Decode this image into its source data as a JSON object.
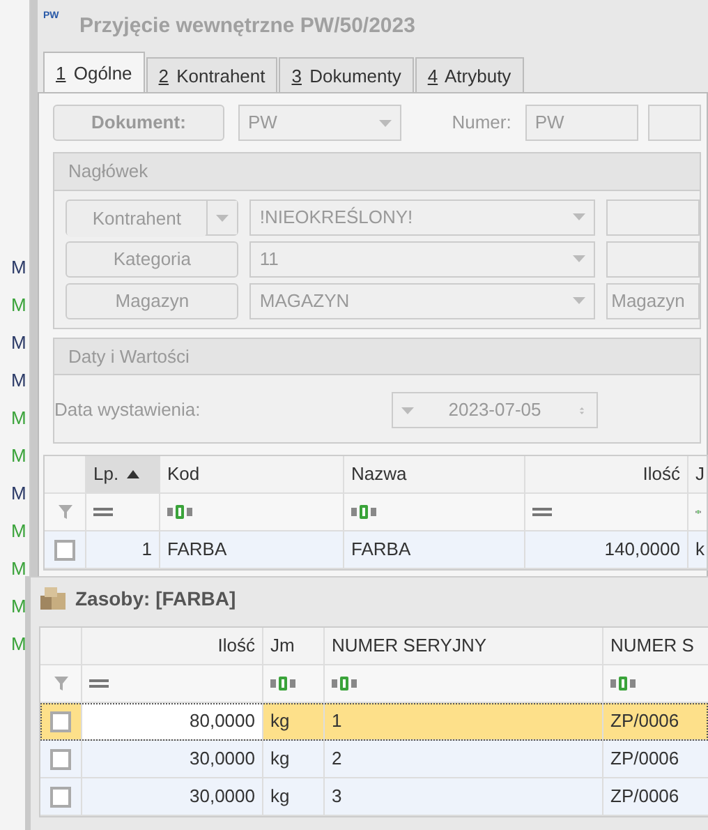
{
  "background_window": {
    "rows": [
      {
        "text": "M",
        "color": "#2b3a67"
      },
      {
        "text": "M",
        "color": "#3aa33a"
      },
      {
        "text": "M",
        "color": "#2b3a67"
      },
      {
        "text": "M",
        "color": "#2b3a67"
      },
      {
        "text": "M",
        "color": "#3aa33a"
      },
      {
        "text": "M",
        "color": "#3aa33a"
      },
      {
        "text": "M",
        "color": "#2b3a67"
      },
      {
        "text": "M",
        "color": "#3aa33a"
      },
      {
        "text": "M",
        "color": "#3aa33a"
      },
      {
        "text": "M",
        "color": "#3aa33a"
      },
      {
        "text": "M",
        "color": "#3aa33a"
      }
    ]
  },
  "window": {
    "icon_text": "PW",
    "title": "Przyjęcie wewnętrzne PW/50/2023"
  },
  "tabs": [
    {
      "key": "1",
      "label": "Ogólne",
      "selected": true
    },
    {
      "key": "2",
      "label": "Kontrahent",
      "selected": false
    },
    {
      "key": "3",
      "label": "Dokumenty",
      "selected": false
    },
    {
      "key": "4",
      "label": "Atrybuty",
      "selected": false
    }
  ],
  "document": {
    "button": "Dokument:",
    "type": "PW",
    "number_label": "Numer:",
    "number_prefix": "PW"
  },
  "header_group": {
    "title": "Nagłówek",
    "rows": [
      {
        "button": "Kontrahent",
        "has_dropdown": true,
        "value": "!NIEOKREŚLONY!"
      },
      {
        "button": "Kategoria",
        "has_dropdown": false,
        "value": "11"
      },
      {
        "button": "Magazyn",
        "has_dropdown": false,
        "value": "MAGAZYN",
        "extra": "Magazyn"
      }
    ]
  },
  "dates_group": {
    "title": "Daty i Wartości",
    "label": "Data wystawienia:",
    "date": "2023-07-05"
  },
  "items_table": {
    "columns": [
      {
        "label": "Lp.",
        "sorted": true,
        "kind": "number"
      },
      {
        "label": "Kod",
        "sorted": false,
        "kind": "text"
      },
      {
        "label": "Nazwa",
        "sorted": false,
        "kind": "text"
      },
      {
        "label": "Ilość",
        "sorted": false,
        "kind": "number"
      },
      {
        "label": "J",
        "sorted": false,
        "kind": "text"
      }
    ],
    "rows": [
      {
        "checked": false,
        "selected": false,
        "cells": [
          "1",
          "FARBA",
          "FARBA",
          "140,0000",
          "k"
        ]
      }
    ]
  },
  "resources_window": {
    "title": "Zasoby: [FARBA]",
    "table": {
      "columns": [
        {
          "label": "Ilość",
          "sorted": false,
          "kind": "number"
        },
        {
          "label": "Jm",
          "sorted": false,
          "kind": "text"
        },
        {
          "label": "NUMER SERYJNY",
          "sorted": false,
          "kind": "text"
        },
        {
          "label": "NUMER S",
          "sorted": false,
          "kind": "text"
        }
      ],
      "rows": [
        {
          "checked": false,
          "selected": true,
          "cells": [
            "80,0000",
            "kg",
            "1",
            "ZP/0006"
          ]
        },
        {
          "checked": false,
          "selected": false,
          "cells": [
            "30,0000",
            "kg",
            "2",
            "ZP/0006"
          ]
        },
        {
          "checked": false,
          "selected": false,
          "cells": [
            "30,0000",
            "kg",
            "3",
            "ZP/0006"
          ]
        }
      ]
    }
  }
}
